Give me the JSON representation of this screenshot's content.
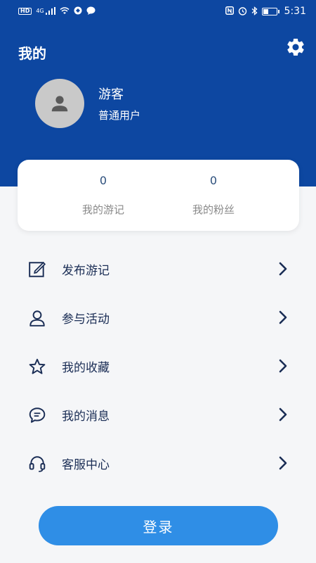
{
  "status_bar": {
    "hd": "HD",
    "network": "4G",
    "time": "5:31",
    "icons_left": [
      "hd-icon",
      "signal-icon",
      "wifi-icon",
      "shield-icon",
      "chat-icon"
    ],
    "icons_right": [
      "nfc-icon",
      "alarm-icon",
      "bluetooth-icon",
      "battery-icon"
    ]
  },
  "header": {
    "title": "我的",
    "user": {
      "name": "游客",
      "type": "普通用户"
    }
  },
  "stats": [
    {
      "value": "0",
      "label": "我的游记"
    },
    {
      "value": "0",
      "label": "我的粉丝"
    }
  ],
  "menu": [
    {
      "label": "发布游记",
      "icon": "edit-icon"
    },
    {
      "label": "参与活动",
      "icon": "person-icon"
    },
    {
      "label": "我的收藏",
      "icon": "star-icon"
    },
    {
      "label": "我的消息",
      "icon": "message-icon"
    },
    {
      "label": "客服中心",
      "icon": "headset-icon"
    }
  ],
  "login": {
    "label": "登录"
  },
  "colors": {
    "primary": "#0d47a1",
    "button": "#2f8ee6",
    "text": "#1a2d55",
    "muted": "#8a8a8a"
  }
}
